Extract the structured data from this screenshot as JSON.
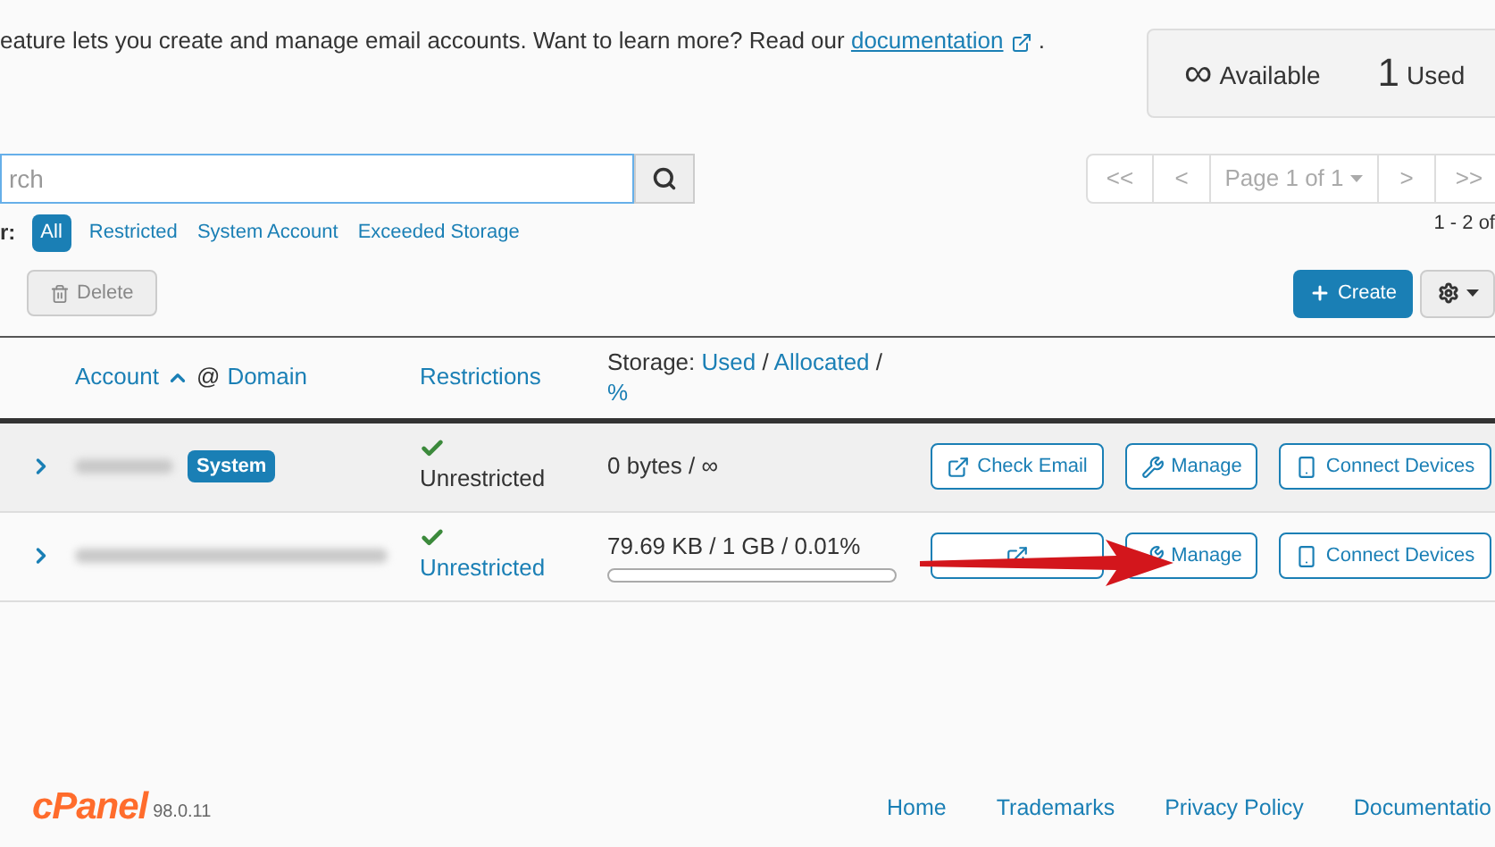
{
  "intro": {
    "text": "eature lets you create and manage email accounts. Want to learn more? Read our",
    "link": "documentation",
    "trailing": "."
  },
  "stats": [
    {
      "value": "∞",
      "label": "Available"
    },
    {
      "value": "1",
      "label": "Used"
    }
  ],
  "search": {
    "placeholder": "rch"
  },
  "pagination": {
    "first": "<<",
    "prev": "<",
    "page": "Page 1 of 1",
    "next": ">",
    "last": ">>",
    "range": "1 - 2 of"
  },
  "filter": {
    "label": "r:",
    "options": [
      {
        "label": "All",
        "selected": true
      },
      {
        "label": "Restricted",
        "selected": false
      },
      {
        "label": "System Account",
        "selected": false
      },
      {
        "label": "Exceeded Storage",
        "selected": false
      }
    ]
  },
  "toolbar": {
    "delete": {
      "label": "Delete",
      "disabled": true
    },
    "create": "Create"
  },
  "table": {
    "columns": {
      "account": "Account",
      "at": "@",
      "domain": "Domain",
      "restrictions": "Restrictions",
      "storage": "Storage:",
      "used": "Used",
      "slash": "/",
      "allocated": "Allocated",
      "percent": "%"
    },
    "rows": [
      {
        "badge": "System",
        "restriction": "Unrestricted",
        "restriction_link": false,
        "storage": "0 bytes / ∞",
        "actions": [
          {
            "kind": "check",
            "label": "Check Email"
          },
          {
            "kind": "manage",
            "label": "Manage"
          },
          {
            "kind": "devices",
            "label": "Connect Devices"
          }
        ]
      },
      {
        "restriction": "Unrestricted",
        "restriction_link": true,
        "storage": "79.69 KB / 1 GB / 0.01%",
        "level": 0.0001,
        "actions": [
          {
            "kind": "check"
          },
          {
            "kind": "manage",
            "label": "Manage"
          },
          {
            "kind": "devices",
            "label": "Connect Devices"
          }
        ]
      }
    ]
  },
  "footer": {
    "logo": "cPanel",
    "version": "98.0.11",
    "links": [
      "Home",
      "Trademarks",
      "Privacy Policy",
      "Documentatio"
    ]
  }
}
